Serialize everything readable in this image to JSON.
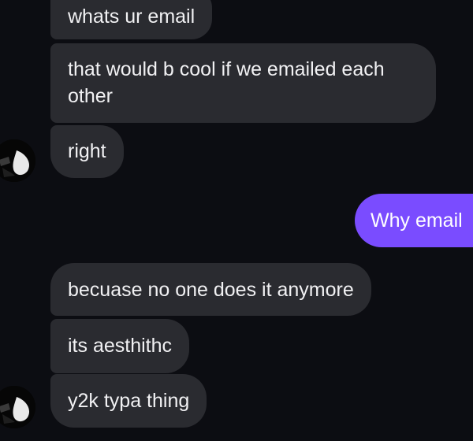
{
  "conversation": {
    "messages": [
      {
        "sender": "them",
        "text": "whats ur email"
      },
      {
        "sender": "them",
        "text": "that would b cool if we emailed each other"
      },
      {
        "sender": "them",
        "text": "right"
      },
      {
        "sender": "me",
        "text": "Why email"
      },
      {
        "sender": "them",
        "text": "becuase no one does it anymore"
      },
      {
        "sender": "them",
        "text": "its aesthithc"
      },
      {
        "sender": "them",
        "text": "y2k typa thing"
      }
    ],
    "colors": {
      "background": "#0c0d12",
      "incoming_bubble": "#2a2b30",
      "outgoing_bubble": "#7a4cff",
      "text": "#f1f1f3"
    },
    "avatar_icon": "contact-avatar-icon"
  }
}
